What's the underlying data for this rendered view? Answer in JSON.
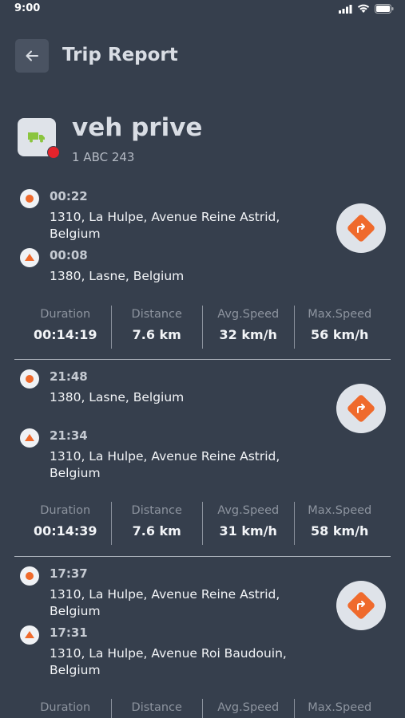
{
  "status_bar": {
    "time": "9:00"
  },
  "header": {
    "title": "Trip Report"
  },
  "vehicle": {
    "name": "veh prive",
    "plate": "1 ABC 243"
  },
  "stat_labels": {
    "duration": "Duration",
    "distance": "Distance",
    "avg_speed": "Avg.Speed",
    "max_speed": "Max.Speed"
  },
  "trips": [
    {
      "end_time": "00:22",
      "end_address": "1310, La Hulpe, Avenue Reine Astrid, Belgium",
      "start_time": "00:08",
      "start_address": "1380, Lasne, Belgium",
      "duration": "00:14:19",
      "distance": "7.6 km",
      "avg_speed": "32 km/h",
      "max_speed": "56 km/h"
    },
    {
      "end_time": "21:48",
      "end_address": "1380, Lasne, Belgium",
      "start_time": "21:34",
      "start_address": "1310, La Hulpe, Avenue Reine Astrid, Belgium",
      "duration": "00:14:39",
      "distance": "7.6 km",
      "avg_speed": "31 km/h",
      "max_speed": "58 km/h"
    },
    {
      "end_time": "17:37",
      "end_address": "1310, La Hulpe, Avenue Reine Astrid, Belgium",
      "start_time": "17:31",
      "start_address": "1310, La Hulpe, Avenue Roi Baudouin, Belgium"
    }
  ],
  "colors": {
    "background": "#363f4d",
    "accent": "#ef6a2c",
    "alert": "#e4232b",
    "truck": "#8bc53f"
  },
  "icons": {
    "back": "arrow-left-icon",
    "direction": "turn-right-icon",
    "vehicle": "truck-icon"
  }
}
